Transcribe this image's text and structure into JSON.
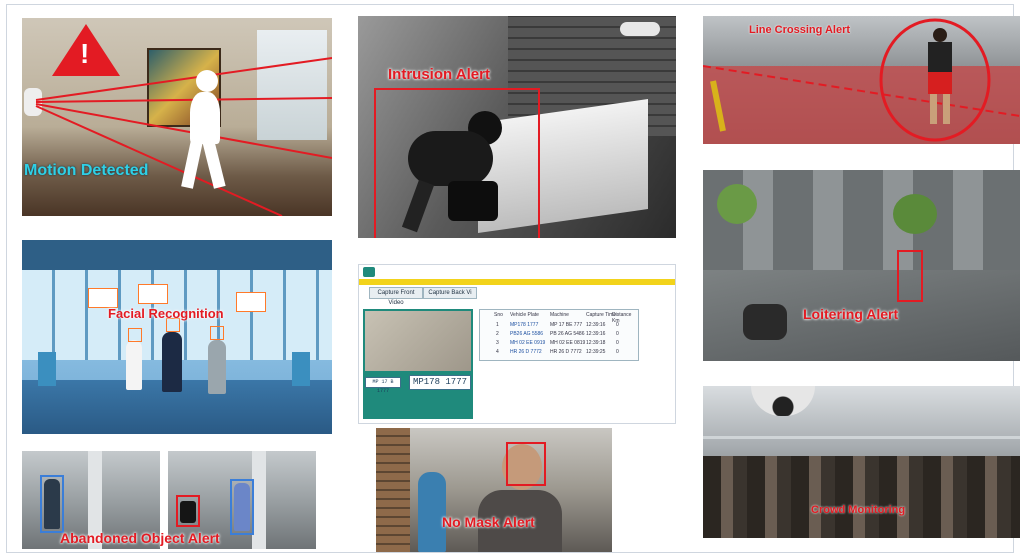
{
  "panels": {
    "motion": {
      "label": "Motion Detected"
    },
    "intrusion": {
      "label": "Intrusion Alert"
    },
    "line_crossing": {
      "label": "Line Crossing Alert"
    },
    "loitering": {
      "label": "Loitering Alert"
    },
    "facial": {
      "label": "Facial Recognition"
    },
    "anpr": {
      "buttons": [
        "Capture Front Video",
        "Capture Back Vi"
      ],
      "plate_small": "MP 17 B 1777",
      "plate_large": "MP178 1777",
      "table_headers": [
        "Sno",
        "Vehicle Plate",
        "Machine",
        "Capture Time",
        "Distance Km"
      ],
      "rows": [
        [
          "1",
          "MP178 1777",
          "MP 17 BE 777",
          "12:39:16",
          "0"
        ],
        [
          "2",
          "PB26 AG 5586",
          "PB 26 AG 5486",
          "12:39:16",
          "0"
        ],
        [
          "3",
          "MH 02 EE 0919",
          "MH 02 EE 0819",
          "12:39:18",
          "0"
        ],
        [
          "4",
          "HR 26 D 7772",
          "HR 26 D 7772",
          "12:39:25",
          "0"
        ]
      ]
    },
    "abandoned": {
      "label": "Abandoned Object Alert"
    },
    "no_mask": {
      "label": "No Mask Alert"
    },
    "crowd": {
      "label": "Crowd Monitoring"
    }
  },
  "colors": {
    "alert_red": "#e31b23",
    "cyan": "#2fd0e6",
    "bar_yellow": "#f2d31b",
    "teal": "#1f8a7c"
  }
}
